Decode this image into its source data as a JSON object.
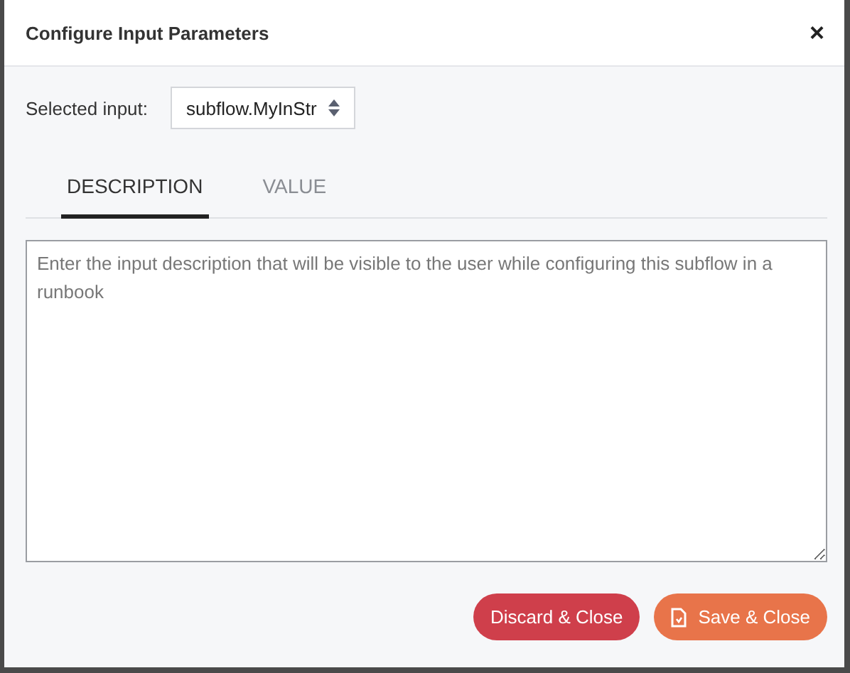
{
  "dialog": {
    "title": "Configure Input Parameters",
    "close": "×"
  },
  "selected_input": {
    "label": "Selected input:",
    "value": "subflow.MyInStr"
  },
  "tabs": [
    {
      "label": "DESCRIPTION",
      "selected": true
    },
    {
      "label": "VALUE",
      "selected": false
    }
  ],
  "description": {
    "placeholder": "Enter the input description that will be visible to the user while configuring this subflow in a runbook"
  },
  "buttons": [
    {
      "kind": "discard",
      "label": "Discard & Close"
    },
    {
      "kind": "save",
      "label": "Save & Close"
    }
  ]
}
